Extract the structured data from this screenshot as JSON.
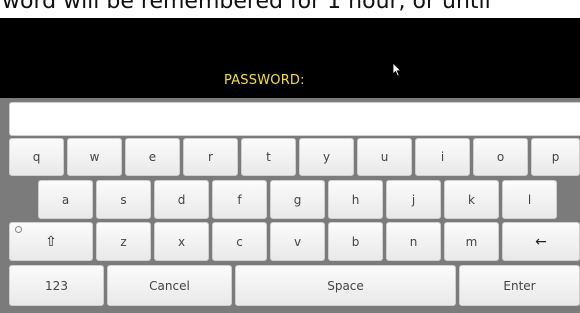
{
  "header": {
    "truncated_text": "word will be remembered for 1 hour, or until"
  },
  "prompt": {
    "label": "PASSWORD:"
  },
  "input": {
    "value": ""
  },
  "keyboard": {
    "row1": [
      "q",
      "w",
      "e",
      "r",
      "t",
      "y",
      "u",
      "i",
      "o",
      "p"
    ],
    "row2": [
      "a",
      "s",
      "d",
      "f",
      "g",
      "h",
      "j",
      "k",
      "l"
    ],
    "row3": {
      "shift": "⇧",
      "letters": [
        "z",
        "x",
        "c",
        "v",
        "b",
        "n",
        "m"
      ],
      "backspace": "←"
    },
    "row4": {
      "numbers": "123",
      "cancel": "Cancel",
      "space": "Space",
      "enter": "Enter"
    }
  },
  "icons": {
    "cursor": "mouse-pointer-icon",
    "shift": "shift-icon",
    "backspace": "backspace-arrow-icon"
  },
  "colors": {
    "prompt": "#f4e21c",
    "keyboard_bg": "#7b7b7b",
    "key_face": "#f4f4f4"
  }
}
